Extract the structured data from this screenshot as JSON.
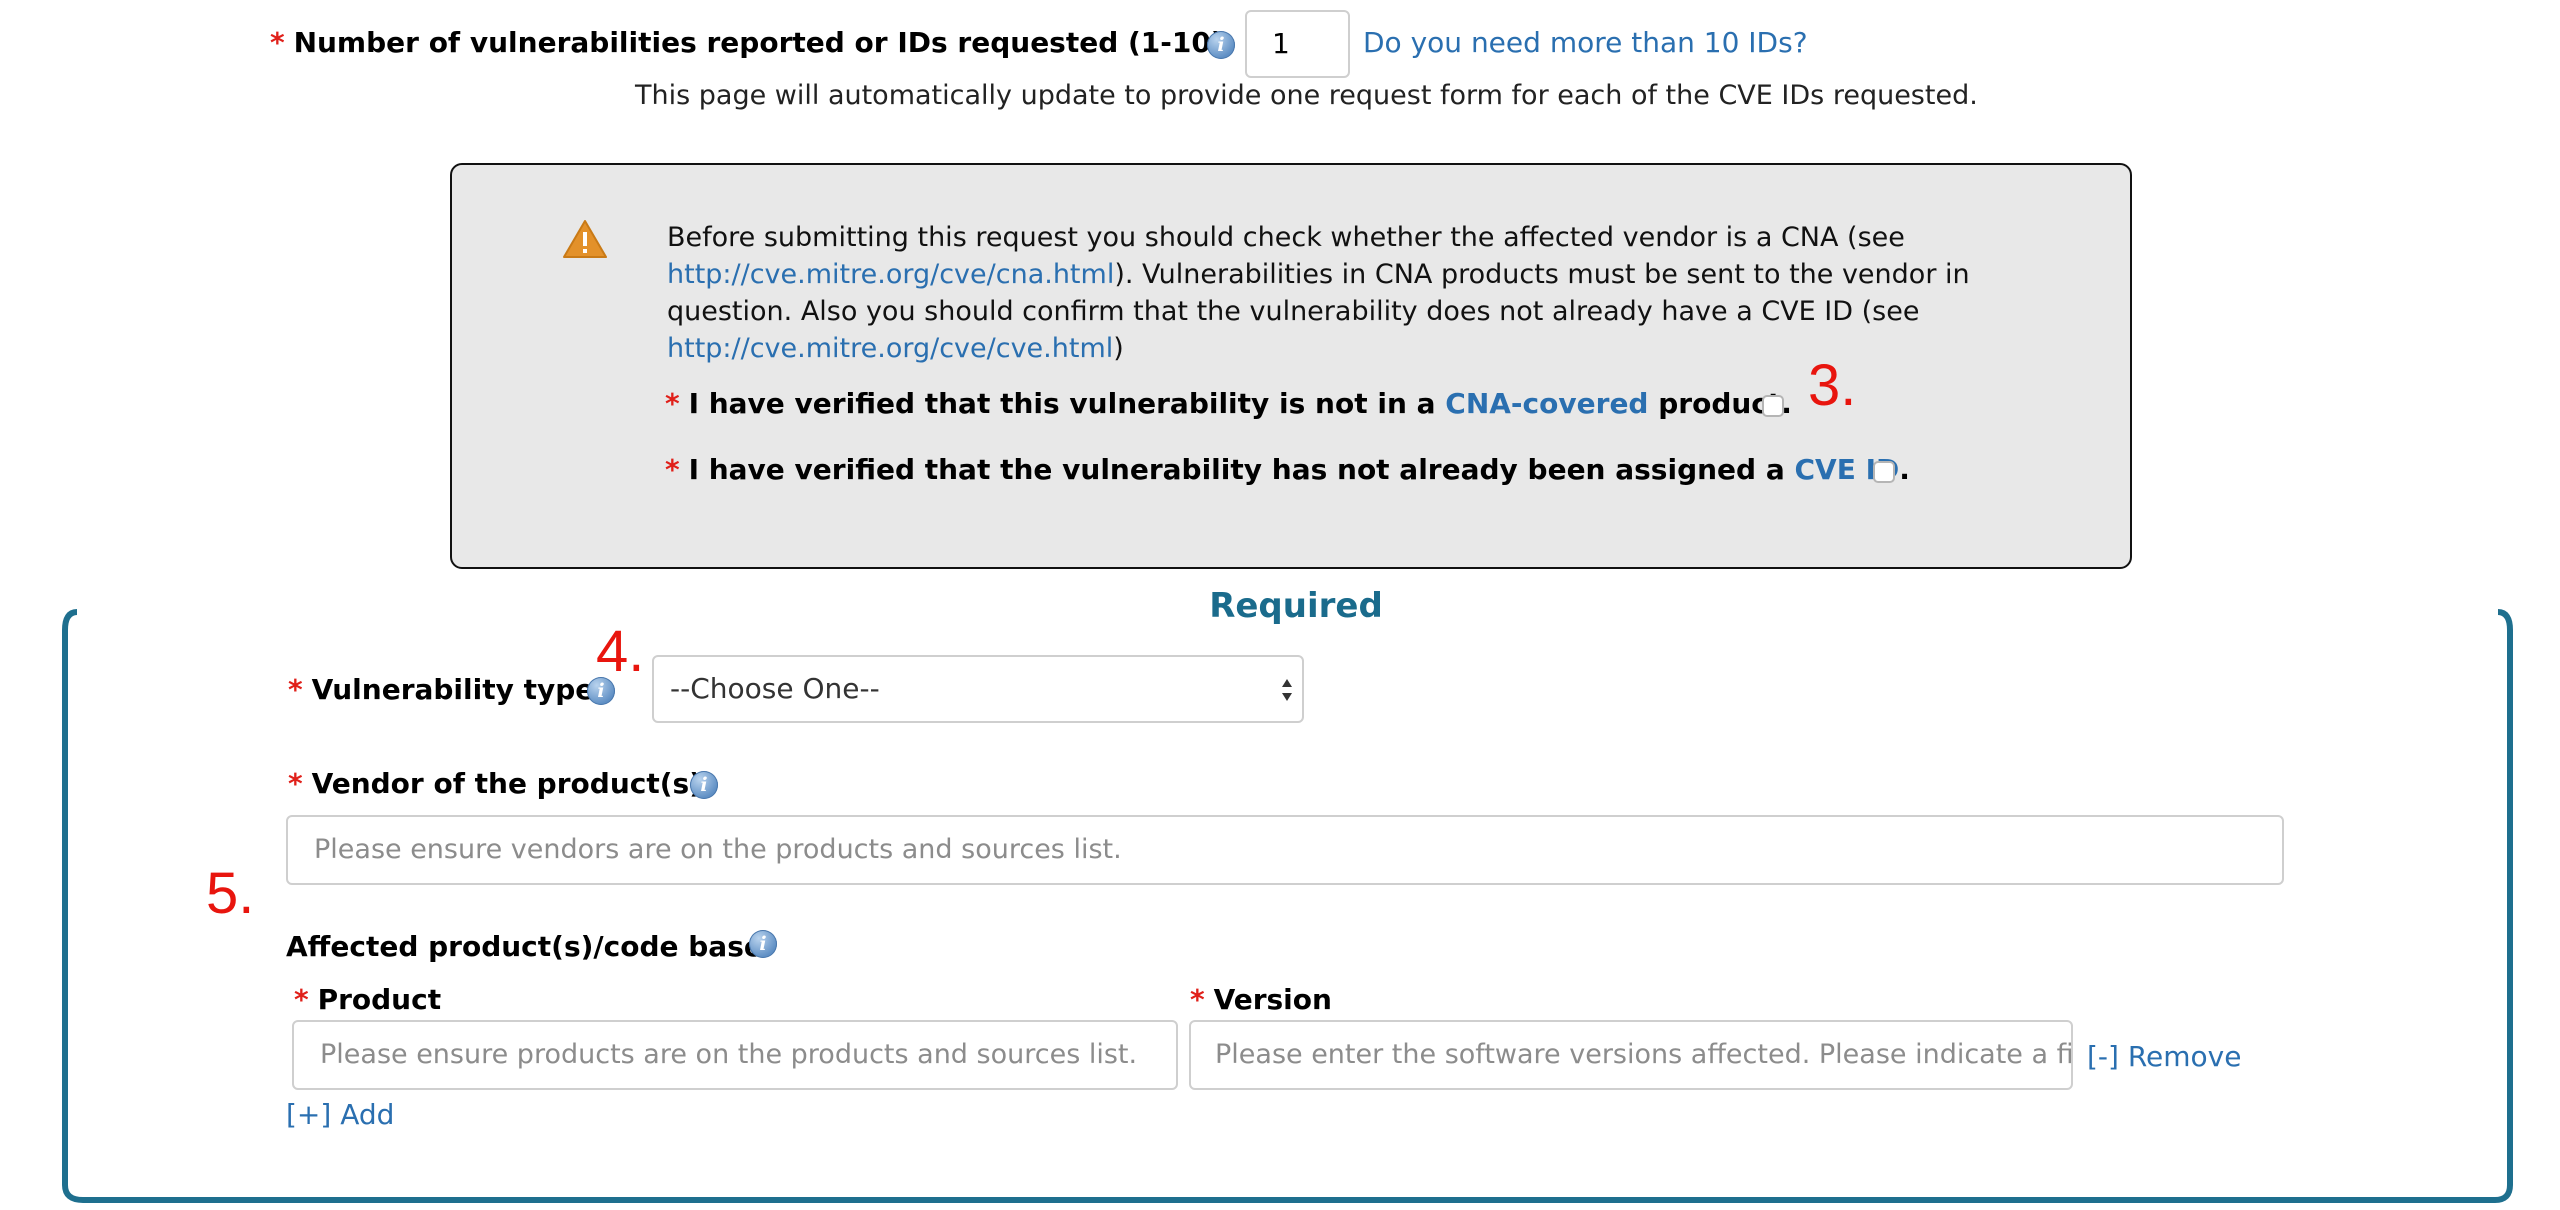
{
  "top": {
    "required_mark": "*",
    "num_label": "Number of vulnerabilities reported or IDs requested (1-10)",
    "num_value": "1",
    "more_ids_link": "Do you need more than 10 IDs?",
    "auto_update_note": "This page will automatically update to provide one request form for each of the CVE IDs requested."
  },
  "warning": {
    "icon": "warning-triangle-icon",
    "text_1": "Before submitting this request you should check whether the affected vendor is a CNA (see",
    "link_1": "http://cve.mitre.org/cve/cna.html",
    "text_2": "). Vulnerabilities in CNA products must be sent to the vendor in",
    "text_3": "question. Also you should confirm that the vulnerability does not already have a CVE ID (see",
    "link_2": "http://cve.mitre.org/cve/cve.html",
    "text_4": ")",
    "check_1_pre": "I have verified that this vulnerability is not in a ",
    "check_1_link": "CNA-covered",
    "check_1_post": " product.",
    "check_2_pre": "I have verified that the vulnerability has not already been assigned a ",
    "check_2_link": "CVE ID",
    "check_2_post": "."
  },
  "annotations": {
    "a3": "3.",
    "a4": "4.",
    "a5": "5."
  },
  "required_section": {
    "title": "Required",
    "vuln_type_label": "Vulnerability type",
    "vuln_type_value": "--Choose One--",
    "vendor_label": "Vendor of the product(s)",
    "vendor_placeholder": "Please ensure vendors are on the products and sources list.",
    "affected_label": "Affected product(s)/code base",
    "product_label": "Product",
    "product_placeholder": "Please ensure products are on the products and sources list.",
    "version_label": "Version",
    "version_placeholder": "Please enter the software versions affected. Please indicate a fi",
    "remove_link": "[-] Remove",
    "add_link": "[+] Add"
  },
  "colors": {
    "section_border": "#1e6f8e",
    "section_title": "#1a6b8c",
    "link": "#2a6fb0",
    "required": "#e0201a",
    "warning_bg": "#e8e8e8",
    "annotation": "#e8150e"
  }
}
